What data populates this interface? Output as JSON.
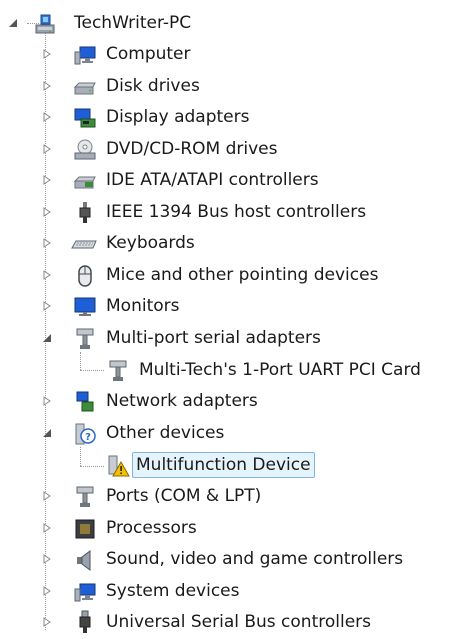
{
  "root": {
    "label": "TechWriter-PC",
    "expanded": true,
    "icon": "computer-tower-icon"
  },
  "categories": [
    {
      "label": "Computer",
      "icon": "computer-monitor-icon",
      "expanded": false
    },
    {
      "label": "Disk drives",
      "icon": "disk-drive-icon",
      "expanded": false
    },
    {
      "label": "Display adapters",
      "icon": "display-adapter-icon",
      "expanded": false
    },
    {
      "label": "DVD/CD-ROM drives",
      "icon": "dvd-drive-icon",
      "expanded": false
    },
    {
      "label": "IDE ATA/ATAPI controllers",
      "icon": "ide-controller-icon",
      "expanded": false
    },
    {
      "label": "IEEE 1394 Bus host controllers",
      "icon": "firewire-plug-icon",
      "expanded": false
    },
    {
      "label": "Keyboards",
      "icon": "keyboard-icon",
      "expanded": false
    },
    {
      "label": "Mice and other pointing devices",
      "icon": "mouse-icon",
      "expanded": false
    },
    {
      "label": "Monitors",
      "icon": "monitor-icon",
      "expanded": false
    },
    {
      "label": "Multi-port serial adapters",
      "icon": "serial-port-icon",
      "expanded": true,
      "children": [
        {
          "label": "Multi-Tech's 1-Port UART PCI Card",
          "icon": "serial-port-icon"
        }
      ]
    },
    {
      "label": "Network adapters",
      "icon": "network-adapter-icon",
      "expanded": false
    },
    {
      "label": "Other devices",
      "icon": "unknown-device-icon",
      "expanded": true,
      "children": [
        {
          "label": "Multifunction Device",
          "icon": "warning-device-icon",
          "selected": true
        }
      ]
    },
    {
      "label": "Ports (COM & LPT)",
      "icon": "port-icon",
      "expanded": false
    },
    {
      "label": "Processors",
      "icon": "processor-chip-icon",
      "expanded": false
    },
    {
      "label": "Sound, video and game controllers",
      "icon": "speaker-icon",
      "expanded": false
    },
    {
      "label": "System devices",
      "icon": "system-devices-icon",
      "expanded": false
    },
    {
      "label": "Universal Serial Bus controllers",
      "icon": "usb-plug-icon",
      "expanded": false
    }
  ],
  "colors": {
    "selection_fill": "#e5f3fb",
    "selection_border": "#7eb4ea",
    "warning": "#f2c200",
    "monitor_screen": "#1e5fd8"
  }
}
